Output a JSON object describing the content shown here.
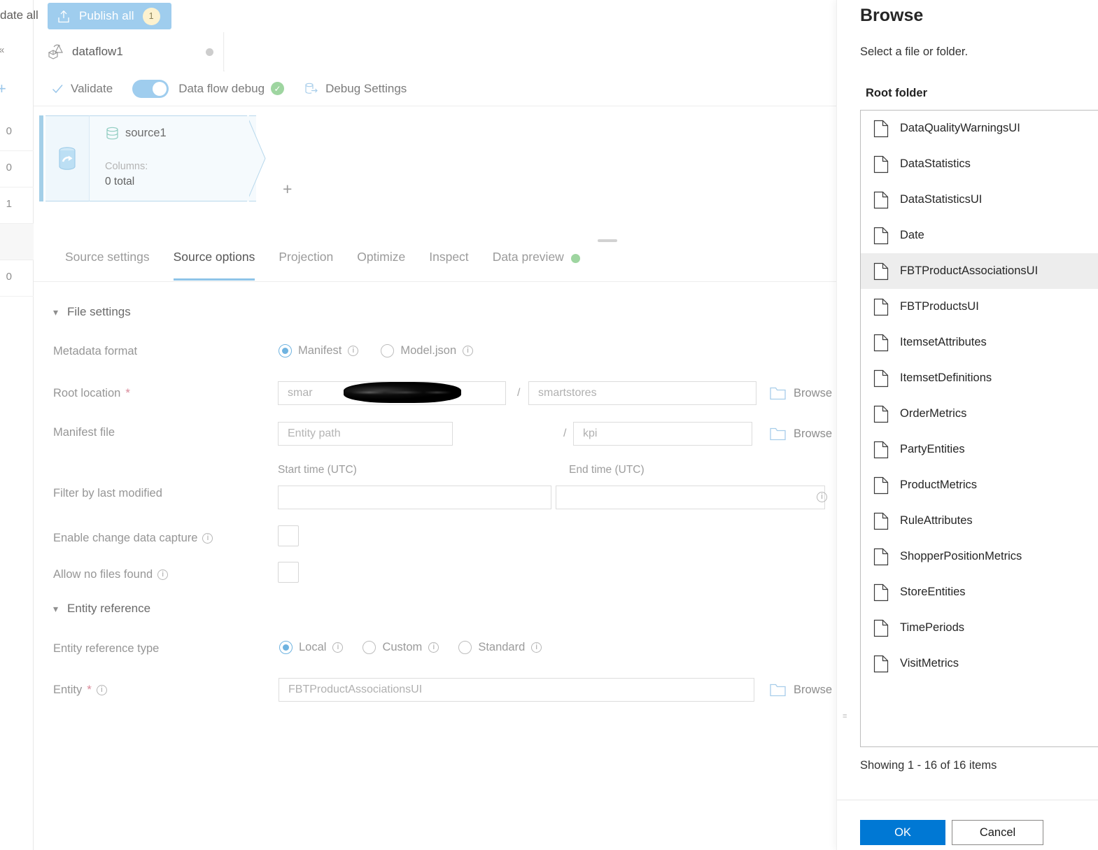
{
  "left_strip": {
    "collapse_icon": "chevron-double-left-icon",
    "add_icon": "plus-icon",
    "rows": [
      {
        "count": "0",
        "selected": false
      },
      {
        "count": "0",
        "selected": false
      },
      {
        "count": "1",
        "selected": false
      },
      {
        "count": "",
        "selected": true
      },
      {
        "count": "0",
        "selected": false
      }
    ]
  },
  "topbar": {
    "validate_all_label": "date all",
    "publish": {
      "label": "Publish all",
      "badge": "1",
      "icon": "publish-upload-icon",
      "bg": "#9fcdee",
      "badge_bg": "#fdf2cf"
    }
  },
  "dataflow_tab": {
    "name": "dataflow1",
    "icon": "dataflow-icon",
    "status_dot": "#cdcdcd"
  },
  "toolbar": {
    "validate_label": "Validate",
    "validate_icon": "checkmark-icon",
    "debug_label": "Data flow debug",
    "debug_toggle_on": true,
    "debug_status_icon": "success-check-icon",
    "debug_settings_label": "Debug Settings",
    "debug_settings_icon": "debug-settings-icon"
  },
  "graph": {
    "node": {
      "name": "source1",
      "icon": "database-source-icon",
      "side_icon": "source-stream-icon",
      "columns_label": "Columns:",
      "columns_value": "0 total",
      "add_icon": "plus-icon"
    }
  },
  "tabs": [
    {
      "label": "Source settings",
      "active": false
    },
    {
      "label": "Source options",
      "active": true
    },
    {
      "label": "Projection",
      "active": false
    },
    {
      "label": "Optimize",
      "active": false
    },
    {
      "label": "Inspect",
      "active": false
    },
    {
      "label": "Data preview",
      "active": false,
      "dot": "#9ed5a0"
    }
  ],
  "form": {
    "file_settings_section": "File settings",
    "entity_reference_section": "Entity reference",
    "metadata_format": {
      "label": "Metadata format",
      "options": [
        {
          "label": "Manifest",
          "selected": true,
          "info": true
        },
        {
          "label": "Model.json",
          "selected": false,
          "info": true
        }
      ]
    },
    "root_location": {
      "label": "Root location",
      "required": true,
      "value_prefix": "smar",
      "value_redacted": true,
      "second_value": "smartstores",
      "separator": "/",
      "browse_label": "Browse",
      "browse_icon": "folder-icon"
    },
    "manifest_file": {
      "label": "Manifest file",
      "placeholder": "Entity path",
      "second_value": "kpi",
      "separator": "/",
      "browse_label": "Browse",
      "browse_icon": "folder-icon"
    },
    "filter_by_last_modified": {
      "label": "Filter by last modified",
      "start_label": "Start time (UTC)",
      "end_label": "End time (UTC)",
      "start_value": "",
      "end_value": "",
      "info": true
    },
    "enable_cdc": {
      "label": "Enable change data capture",
      "checked": false,
      "info": true
    },
    "allow_no_files": {
      "label": "Allow no files found",
      "checked": false,
      "info": true
    },
    "entity_reference_type": {
      "label": "Entity reference type",
      "options": [
        {
          "label": "Local",
          "selected": true,
          "info": true
        },
        {
          "label": "Custom",
          "selected": false,
          "info": true
        },
        {
          "label": "Standard",
          "selected": false,
          "info": true
        }
      ]
    },
    "entity": {
      "label": "Entity",
      "required": true,
      "info": true,
      "value": "FBTProductAssociationsUI",
      "browse_label": "Browse",
      "browse_icon": "folder-icon"
    }
  },
  "panel": {
    "title": "Browse",
    "subtitle": "Select a file or folder.",
    "root_folder_label": "Root folder",
    "items": [
      {
        "name": "DataQualityWarningsUI",
        "selected": false
      },
      {
        "name": "DataStatistics",
        "selected": false
      },
      {
        "name": "DataStatisticsUI",
        "selected": false
      },
      {
        "name": "Date",
        "selected": false
      },
      {
        "name": "FBTProductAssociationsUI",
        "selected": true
      },
      {
        "name": "FBTProductsUI",
        "selected": false
      },
      {
        "name": "ItemsetAttributes",
        "selected": false
      },
      {
        "name": "ItemsetDefinitions",
        "selected": false
      },
      {
        "name": "OrderMetrics",
        "selected": false
      },
      {
        "name": "PartyEntities",
        "selected": false
      },
      {
        "name": "ProductMetrics",
        "selected": false
      },
      {
        "name": "RuleAttributes",
        "selected": false
      },
      {
        "name": "ShopperPositionMetrics",
        "selected": false
      },
      {
        "name": "StoreEntities",
        "selected": false
      },
      {
        "name": "TimePeriods",
        "selected": false
      },
      {
        "name": "VisitMetrics",
        "selected": false
      }
    ],
    "item_icon": "file-document-icon",
    "count_text": "Showing 1 - 16 of 16 items",
    "ok_label": "OK",
    "cancel_label": "Cancel",
    "ok_color": "#0078d4"
  }
}
